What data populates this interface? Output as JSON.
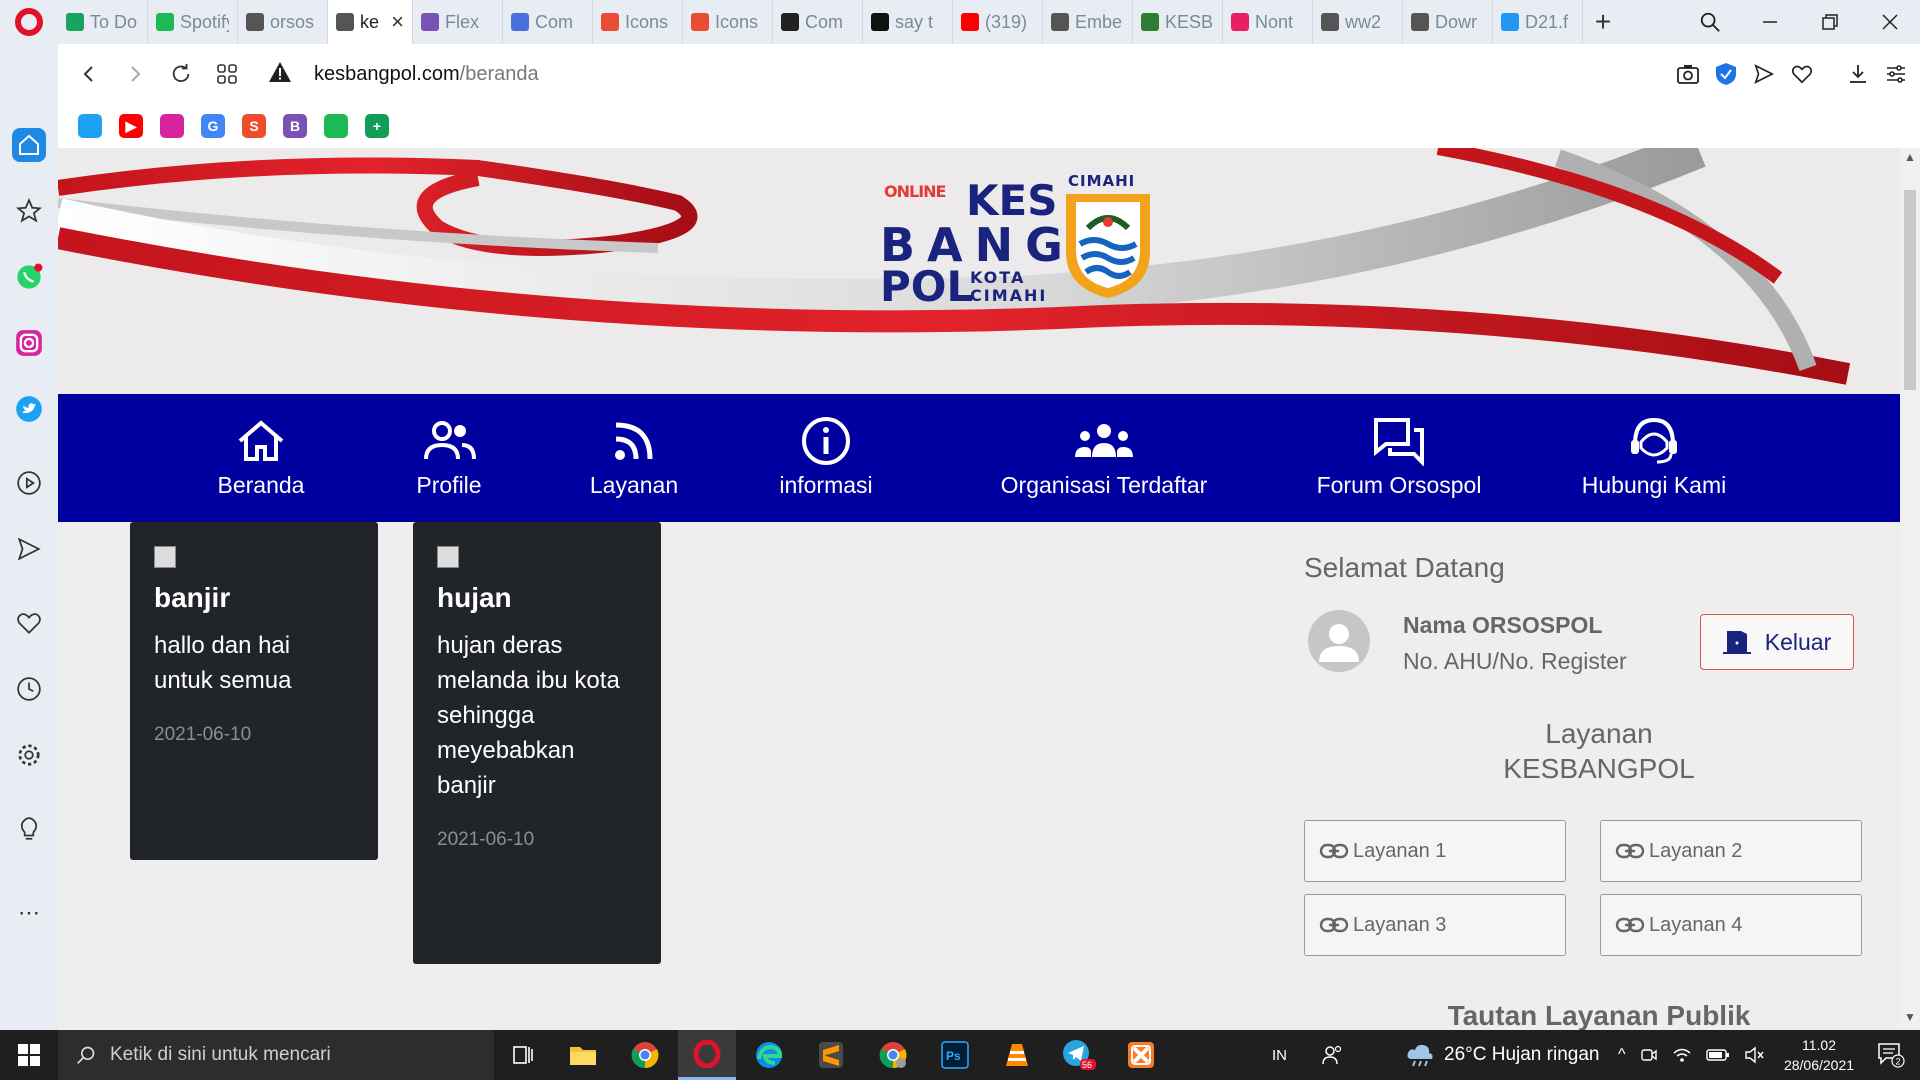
{
  "tabs": [
    {
      "label": "To Do",
      "icon": "microsoft-todo-icon",
      "color": "#1aa260"
    },
    {
      "label": "Spotify",
      "icon": "spotify-icon",
      "color": "#1db954"
    },
    {
      "label": "orsos",
      "icon": "document-icon",
      "color": "#555555"
    },
    {
      "label": "ke",
      "icon": "document-icon",
      "color": "#555555",
      "active": true
    },
    {
      "label": "Flex",
      "icon": "bootstrap-icon",
      "color": "#7952b3"
    },
    {
      "label": "Com",
      "icon": "flag-icon",
      "color": "#4a6fdc"
    },
    {
      "label": "Icons",
      "icon": "icons8-icon",
      "color": "#e94e35"
    },
    {
      "label": "Icons",
      "icon": "icons8-icon",
      "color": "#e94e35"
    },
    {
      "label": "Com",
      "icon": "github-icon",
      "color": "#222222"
    },
    {
      "label": "say t",
      "icon": "ch-icon",
      "color": "#111111"
    },
    {
      "label": "(319)",
      "icon": "youtube-icon",
      "color": "#ff0000"
    },
    {
      "label": "Embe",
      "icon": "document-icon",
      "color": "#555555"
    },
    {
      "label": "KESB",
      "icon": "emblem-icon",
      "color": "#2e7d32"
    },
    {
      "label": "Nont",
      "icon": "pinwheel-icon",
      "color": "#e91e63"
    },
    {
      "label": "ww2",
      "icon": "document-icon",
      "color": "#555555"
    },
    {
      "label": "Dowr",
      "icon": "document-icon",
      "color": "#555555"
    },
    {
      "label": "D21.f",
      "icon": "video-icon",
      "color": "#2196f3"
    }
  ],
  "address": {
    "domain": "kesbangpol.com",
    "path": "/beranda"
  },
  "bookmarks": [
    {
      "name": "twitter-bookmark",
      "color": "#1da1f2",
      "glyph": ""
    },
    {
      "name": "youtube-bookmark",
      "color": "#ff0000",
      "glyph": "▶"
    },
    {
      "name": "instagram-bookmark",
      "color": "#d6249f",
      "glyph": ""
    },
    {
      "name": "google-translate-bookmark",
      "color": "#4285f4",
      "glyph": "G"
    },
    {
      "name": "shopee-bookmark",
      "color": "#ee4d2d",
      "glyph": "S"
    },
    {
      "name": "bootstrap-bookmark",
      "color": "#7952b3",
      "glyph": "B"
    },
    {
      "name": "spotify-bookmark",
      "color": "#1db954",
      "glyph": ""
    },
    {
      "name": "sheets-bookmark",
      "color": "#0f9d58",
      "glyph": "+"
    }
  ],
  "logo": {
    "line1a": "ONLINE",
    "line1b": "KES",
    "line2": "BANG",
    "line3": "POL",
    "kota": "KOTA",
    "cimahi": "CIMAHI",
    "emblem_title": "CIMAHI"
  },
  "nav": [
    {
      "label": "Beranda",
      "icon": "home-icon"
    },
    {
      "label": "Profile",
      "icon": "people-icon"
    },
    {
      "label": "Layanan",
      "icon": "rss-icon"
    },
    {
      "label": "informasi",
      "icon": "info-icon"
    },
    {
      "label": "Organisasi Terdaftar",
      "icon": "group-icon"
    },
    {
      "label": "Forum Orsospol",
      "icon": "forum-icon"
    },
    {
      "label": "Hubungi Kami",
      "icon": "support-agent-icon"
    }
  ],
  "cards": [
    {
      "title": "banjir",
      "text": "hallo dan hai untuk semua",
      "date": "2021-06-10"
    },
    {
      "title": "hujan",
      "text": "hujan deras melanda ibu kota sehingga meyebabkan banjir",
      "date": "2021-06-10"
    }
  ],
  "panel": {
    "welcome": "Selamat Datang",
    "org_name": "Nama ORSOSPOL",
    "org_reg": "No. AHU/No. Register",
    "logout": "Keluar",
    "layanan_heading_1": "Layanan",
    "layanan_heading_2": "KESBANGPOL",
    "layanan": [
      "Layanan 1",
      "Layanan 2",
      "Layanan 3",
      "Layanan 4"
    ],
    "tautan_heading": "Tautan Layanan Publik"
  },
  "taskbar": {
    "search_placeholder": "Ketik di sini untuk mencari",
    "lang": "IN",
    "weather": "26°C  Hujan ringan",
    "time": "11.02",
    "date": "28/06/2021",
    "notif_count": "2",
    "telegram_badge": "56"
  },
  "colors": {
    "navbar": "#0000a0",
    "card_bg": "#212529",
    "accent_red": "#e0112b",
    "logout_border": "#d9534f"
  }
}
